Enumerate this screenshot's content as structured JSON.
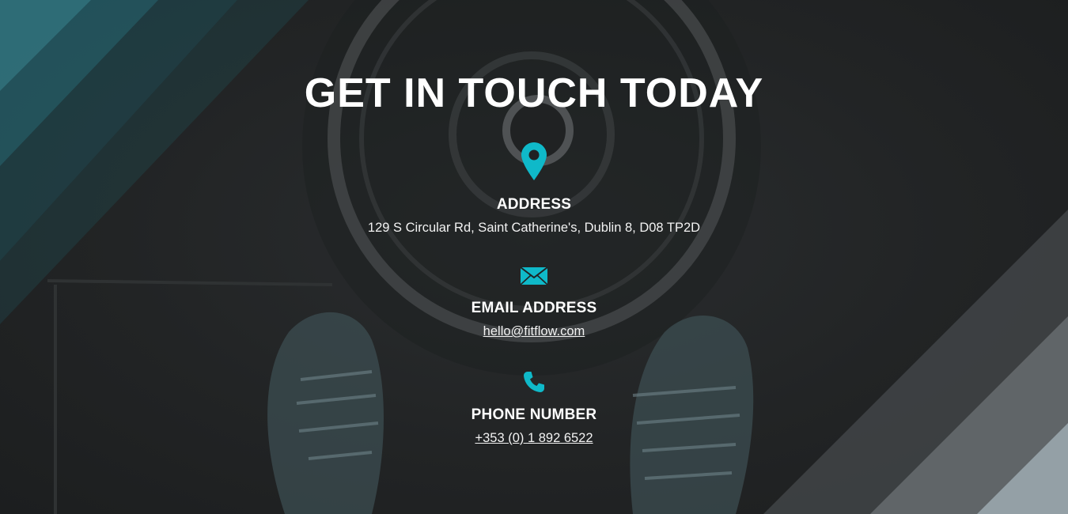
{
  "page": {
    "title": "GET IN TOUCH TODAY",
    "accent_color": "#0fb9c9"
  },
  "contacts": [
    {
      "icon": "map-pin-icon",
      "label": "ADDRESS",
      "value": "129 S Circular Rd, Saint Catherine's, Dublin 8, D08 TP2D"
    },
    {
      "icon": "envelope-icon",
      "label": "EMAIL ADDRESS",
      "value": "hello@fitflow.com"
    },
    {
      "icon": "phone-icon",
      "label": "PHONE NUMBER",
      "value": "+353 (0) 1 892 6522"
    }
  ]
}
